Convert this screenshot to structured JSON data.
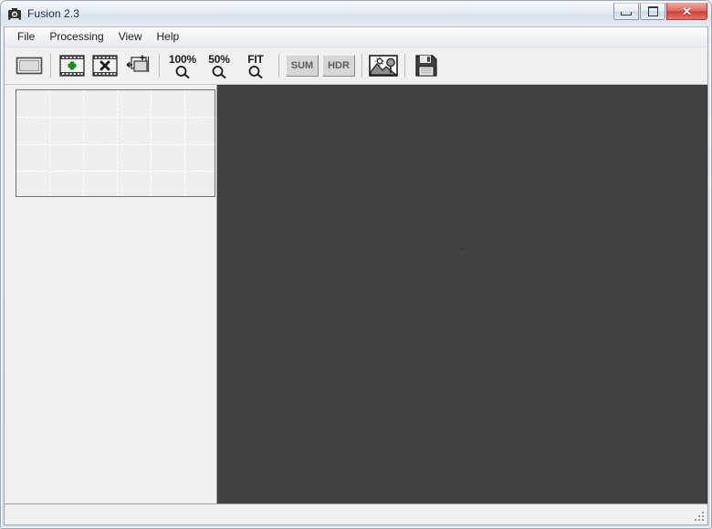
{
  "window": {
    "title": "Fusion 2.3",
    "app_icon": "camera-icon",
    "controls": {
      "minimize_label": "—",
      "maximize_label": "",
      "close_label": "✕"
    }
  },
  "menu": {
    "items": [
      {
        "label": "File"
      },
      {
        "label": "Processing"
      },
      {
        "label": "View"
      },
      {
        "label": "Help"
      }
    ]
  },
  "toolbar": {
    "groups": [
      {
        "buttons": [
          {
            "name": "frame-button",
            "icon": "frame-icon",
            "label": ""
          }
        ]
      },
      {
        "buttons": [
          {
            "name": "add-frames-button",
            "icon": "film-plus-icon",
            "label": ""
          },
          {
            "name": "remove-frames-button",
            "icon": "film-x-icon",
            "label": ""
          },
          {
            "name": "add-to-stack-button",
            "icon": "stack-plus-icon",
            "label": ""
          }
        ]
      },
      {
        "zoom_buttons": [
          {
            "name": "zoom-100-button",
            "label": "100%",
            "icon": "magnifier-icon"
          },
          {
            "name": "zoom-50-button",
            "label": "50%",
            "icon": "magnifier-icon"
          },
          {
            "name": "zoom-fit-button",
            "label": "FIT",
            "icon": "magnifier-icon"
          }
        ]
      },
      {
        "toggles": [
          {
            "name": "sum-toggle",
            "label": "SUM",
            "state": "disabled"
          },
          {
            "name": "hdr-toggle",
            "label": "HDR",
            "state": "disabled"
          }
        ]
      },
      {
        "buttons": [
          {
            "name": "preview-image-button",
            "icon": "landscape-photo-icon",
            "label": ""
          }
        ]
      },
      {
        "buttons": [
          {
            "name": "save-button",
            "icon": "floppy-disk-icon",
            "label": ""
          }
        ]
      }
    ]
  },
  "left_panel": {
    "navigator": {
      "name": "navigator-preview",
      "grid_columns": 5,
      "grid_rows": 3,
      "background_color": "#eeeeee",
      "gridline_color": "#ffffff",
      "border_color": "#6f6f6f"
    },
    "file_list": {
      "name": "frame-list",
      "items": [],
      "empty_text": ""
    }
  },
  "canvas": {
    "name": "image-canvas",
    "background_color": "#414141",
    "content": ""
  },
  "status_bar": {
    "text": "",
    "resize_grip": "resize-grip-icon"
  },
  "colors": {
    "window_chrome": "#f0f0f0",
    "canvas_dark": "#414141",
    "accent_close": "#cf4136",
    "plus_green": "#1f8a1f",
    "title_text": "#0b2440"
  }
}
